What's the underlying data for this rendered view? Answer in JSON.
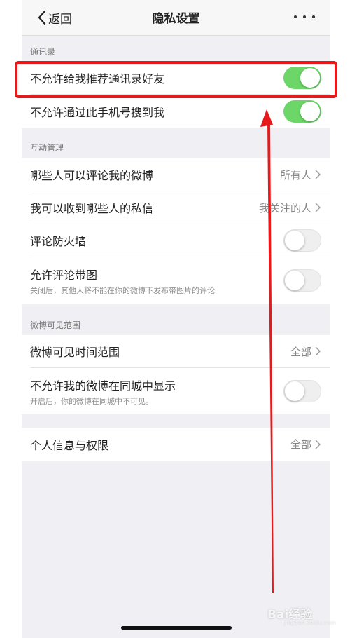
{
  "navbar": {
    "back_label": "返回",
    "title": "隐私设置"
  },
  "sections": {
    "contacts": {
      "header": "通讯录",
      "rows": [
        {
          "label": "不允许给我推荐通讯录好友",
          "toggle": "on"
        },
        {
          "label": "不允许通过此手机号搜到我",
          "toggle": "on"
        }
      ]
    },
    "interaction": {
      "header": "互动管理",
      "rows": [
        {
          "label": "哪些人可以评论我的微博",
          "value": "所有人"
        },
        {
          "label": "我可以收到哪些人的私信",
          "value": "我关注的人"
        },
        {
          "label": "评论防火墙",
          "toggle": "off"
        },
        {
          "label": "允许评论带图",
          "sub": "关闭后，其他人将不能在你的微博下发布带图片的评论",
          "toggle": "off"
        }
      ]
    },
    "visibility": {
      "header": "微博可见范围",
      "rows": [
        {
          "label": "微博可见时间范围",
          "value": "全部"
        },
        {
          "label": "不允许我的微博在同城中显示",
          "sub": "开启后，你的微博在同城中不可见。",
          "toggle": "off"
        }
      ]
    },
    "personal": {
      "rows": [
        {
          "label": "个人信息与权限",
          "value": "全部"
        }
      ]
    }
  },
  "watermark": {
    "text": "Bai经验",
    "sub": "jingyan.baidu.com"
  },
  "colors": {
    "toggle_on": "#6cd669",
    "highlight": "#e8191b",
    "page_bg": "#efeff4"
  }
}
